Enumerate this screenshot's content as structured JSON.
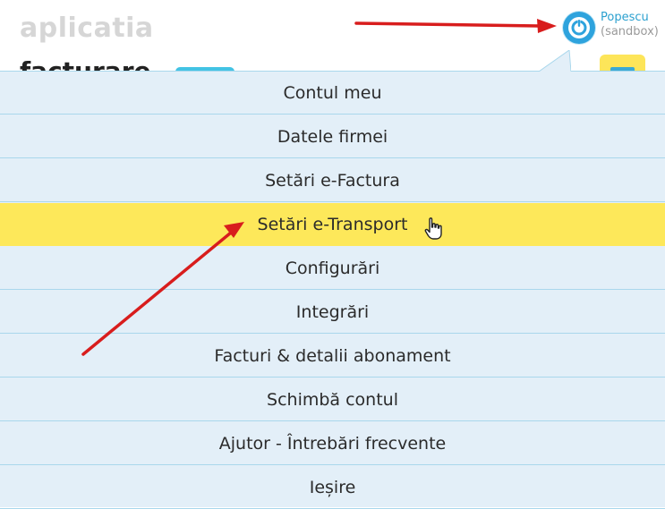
{
  "header": {
    "brand": "aplicatia",
    "brand_sub": "facturare",
    "user": {
      "name": "Popescu",
      "env": "(sandbox)"
    }
  },
  "menu": {
    "items": [
      {
        "label": "Contul meu"
      },
      {
        "label": "Datele firmei"
      },
      {
        "label": "Setări e-Factura"
      },
      {
        "label": "Setări e-Transport",
        "active": true
      },
      {
        "label": "Configurări"
      },
      {
        "label": "Integrări"
      },
      {
        "label": "Facturi & detalii abonament"
      },
      {
        "label": "Schimbă contul"
      },
      {
        "label": "Ajutor - Întrebări frecvente"
      },
      {
        "label": "Ieșire"
      }
    ]
  },
  "colors": {
    "accent_yellow": "#fde85a",
    "menu_bg": "#e3eff8",
    "divider": "#a9d7ec",
    "annotation_arrow": "#d81d1d",
    "avatar_blue": "#2ea3dd"
  }
}
